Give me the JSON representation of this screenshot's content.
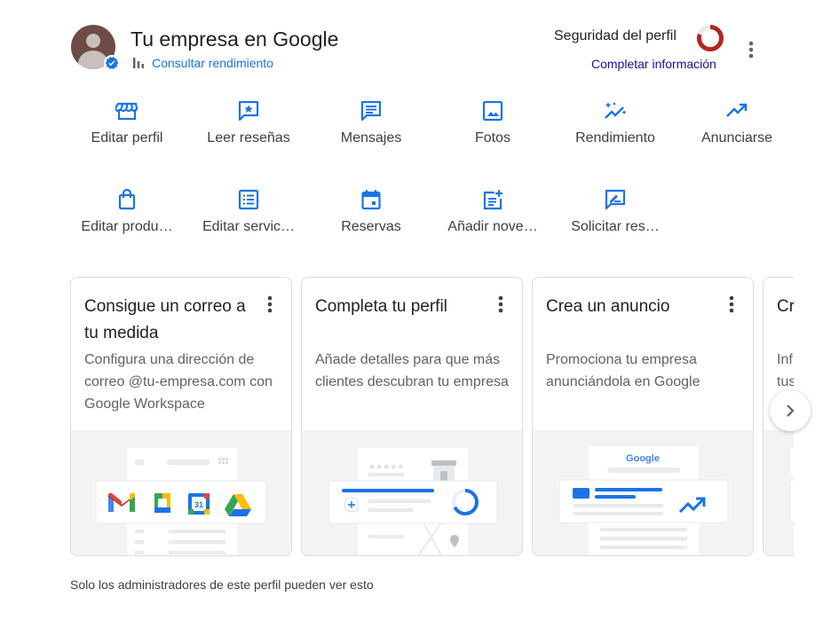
{
  "header": {
    "title": "Tu empresa en Google",
    "performance_link": "Consultar rendimiento",
    "security_label": "Seguridad del perfil",
    "security_link": "Completar información",
    "security_progress": 0.8
  },
  "actions": [
    {
      "label": "Editar perfil",
      "icon": "storefront-icon"
    },
    {
      "label": "Leer reseñas",
      "icon": "review-star-icon"
    },
    {
      "label": "Mensajes",
      "icon": "message-icon"
    },
    {
      "label": "Fotos",
      "icon": "photo-icon"
    },
    {
      "label": "Rendimiento",
      "icon": "sparkle-trend-icon"
    },
    {
      "label": "Anunciarse",
      "icon": "trending-up-icon"
    },
    {
      "label": "Editar produ…",
      "icon": "shopping-bag-icon"
    },
    {
      "label": "Editar servic…",
      "icon": "list-icon"
    },
    {
      "label": "Reservas",
      "icon": "calendar-icon"
    },
    {
      "label": "Añadir nove…",
      "icon": "post-add-icon"
    },
    {
      "label": "Solicitar res…",
      "icon": "rate-review-icon"
    }
  ],
  "cards": [
    {
      "title": "Consigue un correo a tu medida",
      "description": "Configura una dirección de correo @tu-empresa.com con Google Workspace"
    },
    {
      "title": "Completa tu perfil",
      "description": "Añade detalles para que más clientes descubran tu empresa"
    },
    {
      "title": "Crea un anuncio",
      "description": "Promociona tu empresa anunciándola en Google"
    },
    {
      "title": "Cr",
      "description": "Inf tus"
    }
  ],
  "illustrations": {
    "calendar_day": "31",
    "google_wordmark": "Google",
    "stars": "★★★★★"
  },
  "footer": {
    "note": "Solo los administradores de este perfil pueden ver esto"
  },
  "colors": {
    "accent": "#1a73e8",
    "security_ring": "#b3261e",
    "link_dark": "#1a0dab"
  }
}
